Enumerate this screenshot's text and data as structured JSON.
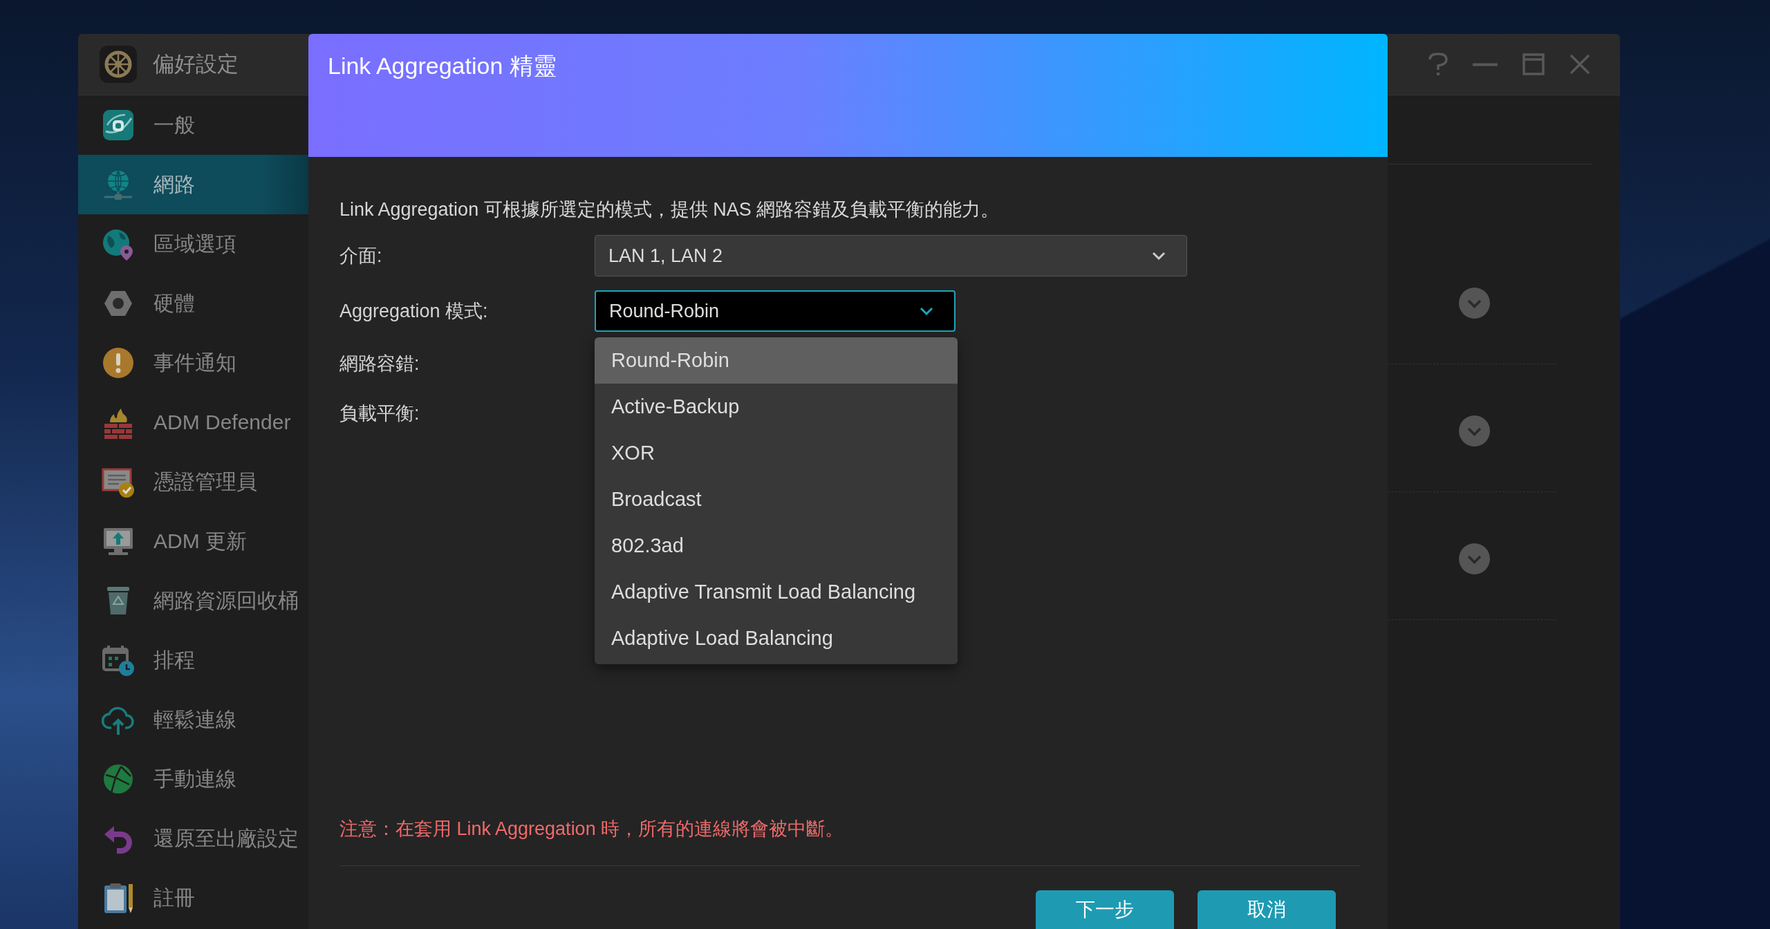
{
  "window": {
    "title": "偏好設定"
  },
  "sidebar": {
    "items": [
      {
        "label": "一般",
        "selected": false
      },
      {
        "label": "網路",
        "selected": true
      },
      {
        "label": "區域選項",
        "selected": false
      },
      {
        "label": "硬體",
        "selected": false
      },
      {
        "label": "事件通知",
        "selected": false
      },
      {
        "label": "ADM Defender",
        "selected": false
      },
      {
        "label": "憑證管理員",
        "selected": false
      },
      {
        "label": "ADM 更新",
        "selected": false
      },
      {
        "label": "網路資源回收桶",
        "selected": false
      },
      {
        "label": "排程",
        "selected": false
      },
      {
        "label": "輕鬆連線",
        "selected": false
      },
      {
        "label": "手動連線",
        "selected": false
      },
      {
        "label": "還原至出廠設定",
        "selected": false
      },
      {
        "label": "註冊",
        "selected": false
      }
    ]
  },
  "sections": [
    {
      "expanded": false
    },
    {
      "expanded": false
    },
    {
      "expanded": false
    }
  ],
  "dialog": {
    "title": "Link Aggregation 精靈",
    "description": "Link Aggregation 可根據所選定的模式，提供 NAS 網路容錯及負載平衡的能力。",
    "fields": [
      {
        "kind": "select",
        "label": "介面:",
        "value": "LAN 1, LAN 2",
        "focused": false,
        "open": false
      },
      {
        "kind": "select",
        "label": "Aggregation 模式:",
        "value": "Round-Robin",
        "focused": true,
        "open": true,
        "options": [
          {
            "label": "Round-Robin",
            "selected": true
          },
          {
            "label": "Active-Backup",
            "selected": false
          },
          {
            "label": "XOR",
            "selected": false
          },
          {
            "label": "Broadcast",
            "selected": false
          },
          {
            "label": "802.3ad",
            "selected": false
          },
          {
            "label": "Adaptive Transmit Load Balancing",
            "selected": false
          },
          {
            "label": "Adaptive Load Balancing",
            "selected": false
          }
        ]
      },
      {
        "kind": "info",
        "label": "網路容錯:"
      },
      {
        "kind": "info",
        "label": "負載平衡:"
      }
    ],
    "warning": "注意：在套用 Link Aggregation 時，所有的連線將會被中斷。",
    "buttons": [
      {
        "label": "下一步"
      },
      {
        "label": "取消"
      }
    ]
  }
}
